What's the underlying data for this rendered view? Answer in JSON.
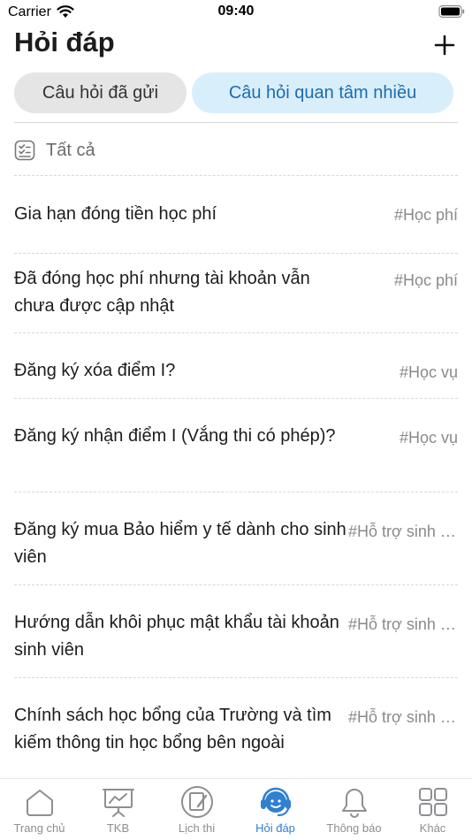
{
  "status_bar": {
    "carrier": "Carrier",
    "time": "09:40"
  },
  "header": {
    "title": "Hỏi đáp",
    "add_icon": "plus-icon"
  },
  "tabs": [
    {
      "label": "Câu hỏi đã gửi",
      "active": false
    },
    {
      "label": "Câu hỏi quan tâm nhiều",
      "active": true
    }
  ],
  "filter": {
    "label": "Tất cả",
    "icon": "filter-list-icon"
  },
  "questions": [
    {
      "text": "Gia hạn đóng tiền học phí",
      "tag": "#Học phí"
    },
    {
      "text": "Đã đóng học phí nhưng tài khoản vẫn chưa được cập nhật",
      "tag": "#Học phí"
    },
    {
      "text": "Đăng ký xóa điểm I?",
      "tag": "#Học vụ"
    },
    {
      "text": "Đăng ký nhận điểm I (Vắng thi có phép)?",
      "tag": "#Học vụ"
    },
    {
      "text": "Đăng ký mua Bảo hiểm y tế dành cho sinh viên",
      "tag": "#Hỗ trợ sinh viên"
    },
    {
      "text": "Hướng dẫn khôi phục mật khẩu tài khoản sinh viên",
      "tag": "#Hỗ trợ sinh viên"
    },
    {
      "text": "Chính sách học bổng của Trường và tìm kiếm thông tin học bổng bên ngoài",
      "tag": "#Hỗ trợ sinh viên"
    }
  ],
  "tabbar": {
    "active_color": "#2f80d1",
    "inactive_color": "#8e8e93",
    "items": [
      {
        "label": "Trang chủ",
        "icon": "home-icon"
      },
      {
        "label": "TKB",
        "icon": "schedule-board-icon"
      },
      {
        "label": "Lịch thi",
        "icon": "exam-calendar-icon"
      },
      {
        "label": "Hỏi đáp",
        "icon": "support-headset-icon",
        "active": true
      },
      {
        "label": "Thông báo",
        "icon": "bell-icon"
      },
      {
        "label": "Khác",
        "icon": "grid-icon"
      }
    ]
  }
}
